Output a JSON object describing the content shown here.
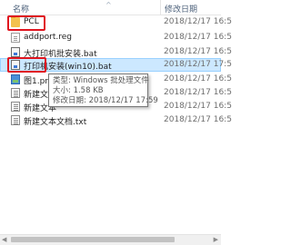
{
  "header": {
    "name_label": "名称",
    "date_label": "修改日期",
    "sort_arrow": "^"
  },
  "rows": [
    {
      "name": "PCL",
      "date": "2018/12/17 16:5",
      "icon": "folder-icon",
      "highlighted": true
    },
    {
      "name": "addport.reg",
      "date": "2018/12/17 16:5",
      "icon": "reg-file-icon"
    },
    {
      "name": "大打印机批安装.bat",
      "date": "2018/12/17 16:5",
      "icon": "bat-file-icon"
    },
    {
      "name": "打印机安装(win10).bat",
      "date": "2018/12/17 17:5",
      "icon": "bat-file-icon",
      "selected": true,
      "highlighted": true
    },
    {
      "name": "图1.png",
      "date": "2018/12/17 16:5",
      "icon": "image-file-icon"
    },
    {
      "name": "新建文本",
      "date": "2018/12/17 16:5",
      "icon": "text-file-icon"
    },
    {
      "name": "新建文本",
      "date": "2018/12/17 16:5",
      "icon": "text-file-icon"
    },
    {
      "name": "新建文本文档.txt",
      "date": "2018/12/17 16:5",
      "icon": "text-file-icon"
    }
  ],
  "tooltip": {
    "type": "类型: Windows 批处理文件",
    "size": "大小: 1.58 KB",
    "modified": "修改日期: 2018/12/17 17:59"
  },
  "colors": {
    "highlight_box": "#e0141e",
    "selection": "#cce8ff"
  }
}
